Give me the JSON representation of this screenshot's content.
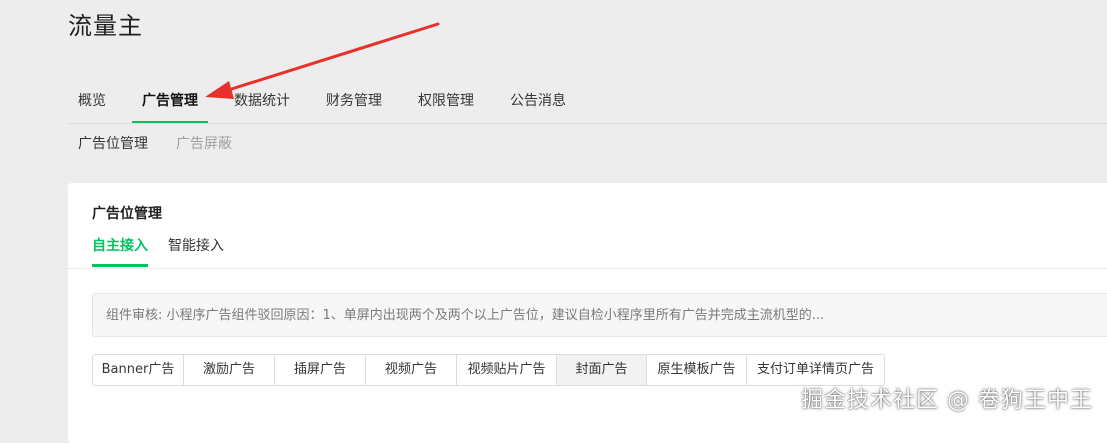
{
  "app": {
    "title": "流量主"
  },
  "top_nav": {
    "tabs": [
      {
        "label": "概览"
      },
      {
        "label": "广告管理"
      },
      {
        "label": "数据统计"
      },
      {
        "label": "财务管理"
      },
      {
        "label": "权限管理"
      },
      {
        "label": "公告消息"
      }
    ],
    "active_index": 1
  },
  "sub_nav": {
    "items": [
      {
        "label": "广告位管理"
      },
      {
        "label": "广告屏蔽"
      }
    ]
  },
  "card": {
    "title": "广告位管理",
    "access_tabs": [
      {
        "label": "自主接入"
      },
      {
        "label": "智能接入"
      }
    ],
    "notice": "组件审核: 小程序广告组件驳回原因：1、单屏内出现两个及两个以上广告位，建议自检小程序里所有广告并完成主流机型的...",
    "ad_types": [
      {
        "label": "Banner广告"
      },
      {
        "label": "激励广告"
      },
      {
        "label": "插屏广告"
      },
      {
        "label": "视频广告"
      },
      {
        "label": "视频贴片广告"
      },
      {
        "label": "封面广告"
      },
      {
        "label": "原生模板广告"
      },
      {
        "label": "支付订单详情页广告"
      }
    ],
    "selected_ad_type_index": 5
  },
  "colors": {
    "accent": "#07c160",
    "annotation_arrow": "#e8312a"
  },
  "watermark": "掘金技术社区 @ 卷狗王中王"
}
